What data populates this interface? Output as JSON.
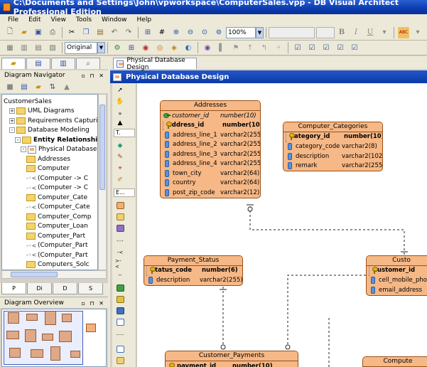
{
  "window": {
    "title": "C:\\Documents and Settings\\John\\vpworkspace\\ComputerSales.vpp - DB Visual Architect Professional Edition"
  },
  "menu": [
    "File",
    "Edit",
    "View",
    "Tools",
    "Window",
    "Help"
  ],
  "toolbar": {
    "zoom": "100%",
    "style_select": "Original"
  },
  "navigator": {
    "title": "Diagram Navigator",
    "tree": [
      {
        "label": "CustomerSales",
        "indent": 0,
        "icon": "none",
        "expander": ""
      },
      {
        "label": "UML Diagrams",
        "indent": 1,
        "icon": "folder",
        "expander": "+"
      },
      {
        "label": "Requirements Capturing",
        "indent": 1,
        "icon": "folder",
        "expander": "+"
      },
      {
        "label": "Database Modeling",
        "indent": 1,
        "icon": "folder",
        "expander": "-"
      },
      {
        "label": "Entity Relationship Dia",
        "indent": 2,
        "icon": "folder",
        "expander": "-"
      },
      {
        "label": "Physical Database D",
        "indent": 3,
        "icon": "diagram",
        "expander": "-"
      },
      {
        "label": "Addresses",
        "indent": 4,
        "icon": "folder",
        "expander": ""
      },
      {
        "label": "Computer",
        "indent": 4,
        "icon": "folder",
        "expander": ""
      },
      {
        "label": "(Computer -> C",
        "indent": 4,
        "icon": "relation",
        "expander": ""
      },
      {
        "label": "(Computer -> C",
        "indent": 4,
        "icon": "relation",
        "expander": ""
      },
      {
        "label": "Computer_Cate",
        "indent": 4,
        "icon": "folder",
        "expander": ""
      },
      {
        "label": "(Computer_Cate",
        "indent": 4,
        "icon": "relation",
        "expander": ""
      },
      {
        "label": "Computer_Comp",
        "indent": 4,
        "icon": "folder",
        "expander": ""
      },
      {
        "label": "Computer_Loan",
        "indent": 4,
        "icon": "folder",
        "expander": ""
      },
      {
        "label": "Computer_Part",
        "indent": 4,
        "icon": "folder",
        "expander": ""
      },
      {
        "label": "(Computer_Part",
        "indent": 4,
        "icon": "relation",
        "expander": ""
      },
      {
        "label": "(Computer_Part",
        "indent": 4,
        "icon": "relation",
        "expander": ""
      },
      {
        "label": "Computers_Solc",
        "indent": 4,
        "icon": "folder",
        "expander": ""
      }
    ]
  },
  "bottom_tabs": [
    "P",
    "Di",
    "D",
    "S"
  ],
  "overview": {
    "title": "Diagram Overview"
  },
  "document_tab": "Physical Database Design",
  "diagram_title": "Physical Database Design",
  "palette_labels": {
    "text": "T",
    "er": "E"
  },
  "entities": {
    "addresses": {
      "name": "Addresses",
      "columns": [
        {
          "name": "customer_id",
          "type": "number(10)",
          "kind": "fk"
        },
        {
          "name": "address_id",
          "type": "number(10)",
          "kind": "pk"
        },
        {
          "name": "address_line_1",
          "type": "varchar2(255)",
          "kind": "col"
        },
        {
          "name": "address_line_2",
          "type": "varchar2(255)",
          "kind": "col"
        },
        {
          "name": "address_line_3",
          "type": "varchar2(255)",
          "kind": "col"
        },
        {
          "name": "address_line_4",
          "type": "varchar2(255)",
          "kind": "col"
        },
        {
          "name": "town_city",
          "type": "varchar2(64)",
          "kind": "col"
        },
        {
          "name": "country",
          "type": "varchar2(64)",
          "kind": "col"
        },
        {
          "name": "post_zip_code",
          "type": "varchar2(12)",
          "kind": "col"
        }
      ]
    },
    "computer_categories": {
      "name": "Computer_Categories",
      "columns": [
        {
          "name": "category_id",
          "type": "number(10)",
          "kind": "pk"
        },
        {
          "name": "category_code",
          "type": "varchar2(8)",
          "kind": "col"
        },
        {
          "name": "description",
          "type": "varchar2(1024)",
          "kind": "col"
        },
        {
          "name": "remark",
          "type": "varchar2(255)",
          "kind": "col"
        }
      ]
    },
    "payment_status": {
      "name": "Payment_Status",
      "columns": [
        {
          "name": "status_code",
          "type": "number(6)",
          "kind": "pk"
        },
        {
          "name": "description",
          "type": "varchar2(255)",
          "kind": "col"
        }
      ]
    },
    "customers": {
      "name": "Custo",
      "columns": [
        {
          "name": "customer_id",
          "type": "",
          "kind": "pk"
        },
        {
          "name": "cell_mobile_phone",
          "type": "",
          "kind": "col"
        },
        {
          "name": "email_address",
          "type": "",
          "kind": "col"
        }
      ]
    },
    "customer_payments": {
      "name": "Customer_Payments",
      "columns": [
        {
          "name": "payment_id",
          "type": "number(10)",
          "kind": "pk"
        }
      ]
    },
    "computers": {
      "name": "Compute",
      "columns": []
    }
  }
}
